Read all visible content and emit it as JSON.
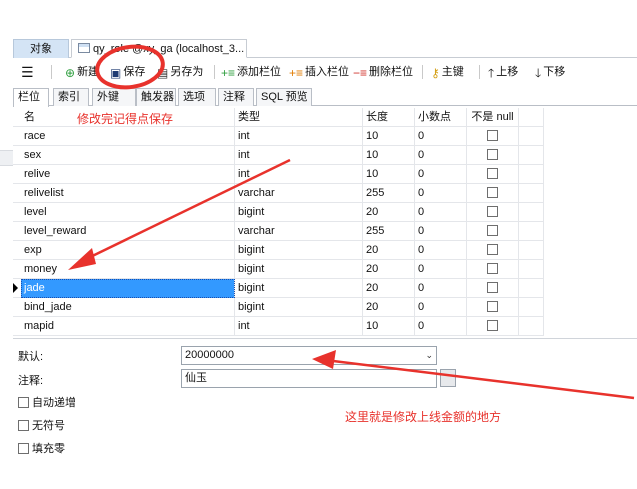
{
  "doc_tabs": {
    "objects": "对象",
    "table": "qy_role @xy_ga (localhost_3..."
  },
  "toolbar": {
    "menu": "☰",
    "new": "新建",
    "save": "保存",
    "save_as": "另存为",
    "add_field": "添加栏位",
    "insert_field": "插入栏位",
    "delete_field": "删除栏位",
    "primary_key": "主键",
    "move_up": "上移",
    "move_down": "下移"
  },
  "sub_tabs": [
    "栏位",
    "索引",
    "外键",
    "触发器",
    "选项",
    "注释",
    "SQL 预览"
  ],
  "columns": {
    "name": "名",
    "type": "类型",
    "length": "长度",
    "decimals": "小数点",
    "not_null": "不是 null"
  },
  "rows": [
    {
      "name": "race",
      "type": "int",
      "length": "10",
      "decimals": "0"
    },
    {
      "name": "sex",
      "type": "int",
      "length": "10",
      "decimals": "0"
    },
    {
      "name": "relive",
      "type": "int",
      "length": "10",
      "decimals": "0"
    },
    {
      "name": "relivelist",
      "type": "varchar",
      "length": "255",
      "decimals": "0"
    },
    {
      "name": "level",
      "type": "bigint",
      "length": "20",
      "decimals": "0"
    },
    {
      "name": "level_reward",
      "type": "varchar",
      "length": "255",
      "decimals": "0"
    },
    {
      "name": "exp",
      "type": "bigint",
      "length": "20",
      "decimals": "0"
    },
    {
      "name": "money",
      "type": "bigint",
      "length": "20",
      "decimals": "0"
    },
    {
      "name": "jade",
      "type": "bigint",
      "length": "20",
      "decimals": "0"
    },
    {
      "name": "bind_jade",
      "type": "bigint",
      "length": "20",
      "decimals": "0"
    },
    {
      "name": "mapid",
      "type": "int",
      "length": "10",
      "decimals": "0"
    }
  ],
  "properties": {
    "default_label": "默认:",
    "default_value": "20000000",
    "comment_label": "注释:",
    "comment_value": "仙玉",
    "auto_increment": "自动递增",
    "unsigned": "无符号",
    "zerofill": "填充零"
  },
  "annotations": {
    "save_note": "修改完记得点保存",
    "amount_note": "这里就是修改上线金额的地方"
  },
  "colors": {
    "annotation": "#e8322c",
    "selection": "#3399ff",
    "active_tab": "#d4e4f5"
  }
}
